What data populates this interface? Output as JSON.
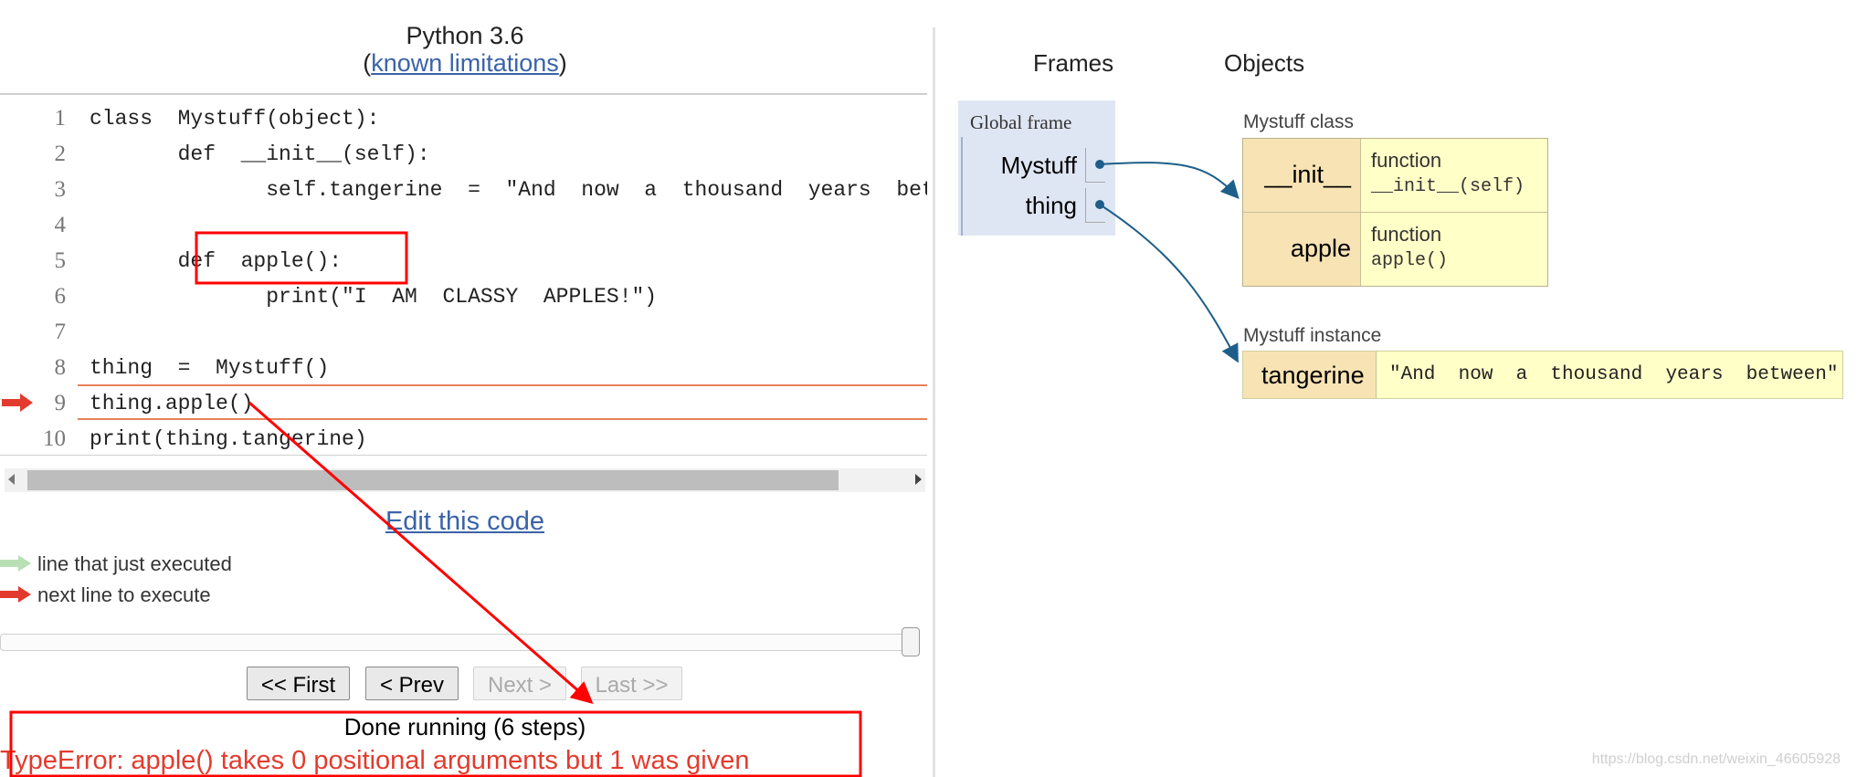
{
  "header": {
    "language": "Python 3.6",
    "limitations_open": "(",
    "limitations_link": "known limitations",
    "limitations_close": ")"
  },
  "code": {
    "lines": [
      {
        "num": "1",
        "text": "class  Mystuff(object):"
      },
      {
        "num": "2",
        "text": "       def  __init__(self):"
      },
      {
        "num": "3",
        "text": "              self.tangerine  =  \"And  now  a  thousand  years  between\""
      },
      {
        "num": "4",
        "text": ""
      },
      {
        "num": "5",
        "text": "       def  apple():"
      },
      {
        "num": "6",
        "text": "              print(\"I  AM  CLASSY  APPLES!\")"
      },
      {
        "num": "7",
        "text": ""
      },
      {
        "num": "8",
        "text": "thing  =  Mystuff()"
      },
      {
        "num": "9",
        "text": "thing.apple()"
      },
      {
        "num": "10",
        "text": "print(thing.tangerine)"
      }
    ],
    "current_line": 9
  },
  "edit_link": "Edit this code",
  "legend": {
    "just_executed": "line that just executed",
    "next_to_execute": "next line to execute"
  },
  "navigation": {
    "first": "<< First",
    "prev": "< Prev",
    "next": "Next >",
    "last": "Last >>",
    "next_enabled": false,
    "last_enabled": false
  },
  "status": {
    "done": "Done running (6 steps)",
    "error": "TypeError: apple() takes 0 positional arguments but 1 was given"
  },
  "viz": {
    "frames_title": "Frames",
    "objects_title": "Objects",
    "global_frame": {
      "title": "Global frame",
      "variables": [
        "Mystuff",
        "thing"
      ]
    },
    "class_object": {
      "label": "Mystuff class",
      "attributes": [
        {
          "name": "__init__",
          "kind": "function",
          "signature": "__init__(self)"
        },
        {
          "name": "apple",
          "kind": "function",
          "signature": "apple()"
        }
      ]
    },
    "instance_object": {
      "label": "Mystuff instance",
      "attribute": "tangerine",
      "value": "\"And  now  a  thousand  years  between\""
    }
  },
  "watermark": "https://blog.csdn.net/weixin_46605928",
  "colors": {
    "next_arrow": "#e23b2e",
    "just_arrow": "#b9e0b4",
    "link": "#3a63a8",
    "pointer": "#1d5f8a",
    "annotation": "#ff0000"
  }
}
